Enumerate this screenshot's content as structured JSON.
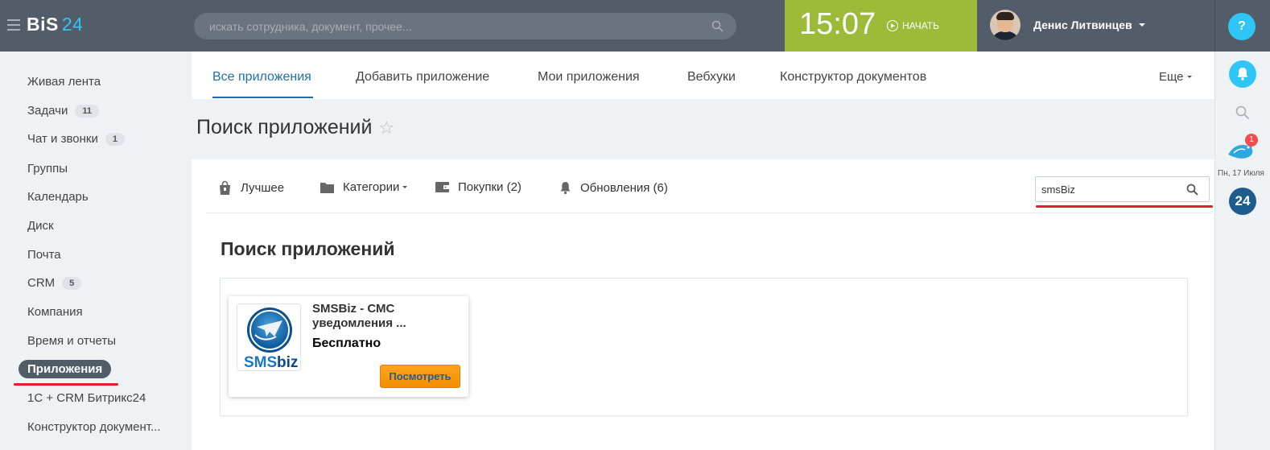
{
  "header": {
    "logo_text": "BiS",
    "logo_num": "24",
    "search_placeholder": "искать сотрудника, документ, прочее...",
    "time": "15:07",
    "start_label": "НАЧАТЬ",
    "user_name": "Денис Литвинцев",
    "help_label": "?"
  },
  "sidebar": {
    "items": [
      {
        "label": "Живая лента"
      },
      {
        "label": "Задачи",
        "badge": "11"
      },
      {
        "label": "Чат и звонки",
        "badge": "1"
      },
      {
        "label": "Группы"
      },
      {
        "label": "Календарь"
      },
      {
        "label": "Диск"
      },
      {
        "label": "Почта"
      },
      {
        "label": "CRM",
        "badge": "5"
      },
      {
        "label": "Компания"
      },
      {
        "label": "Время и отчеты"
      },
      {
        "label": "Приложения",
        "active": true
      },
      {
        "label": "1С + CRM Битрикс24"
      },
      {
        "label": "Конструктор документ..."
      }
    ]
  },
  "rightbar": {
    "notif_count": "1",
    "date": "Пн, 17 Июля",
    "b24_label": "24"
  },
  "tabs": [
    {
      "label": "Все приложения",
      "active": true
    },
    {
      "label": "Добавить приложение"
    },
    {
      "label": "Мои приложения"
    },
    {
      "label": "Вебхуки"
    },
    {
      "label": "Конструктор документов"
    }
  ],
  "more_label": "Еще",
  "page_title": "Поиск приложений",
  "subnav": {
    "best": "Лучшее",
    "categories": "Категории",
    "purchases": "Покупки (2)",
    "updates": "Обновления (6)",
    "search_value": "smsBiz"
  },
  "results": {
    "title": "Поиск приложений",
    "apps": [
      {
        "name": "SMSBiz - СМС уведомления ...",
        "price": "Бесплатно",
        "button": "Посмотреть",
        "logo_text_sms": "SMS",
        "logo_text_biz": "biz"
      }
    ]
  },
  "colors": {
    "topbar": "#535c69",
    "accent": "#2fc6f6",
    "time_bg": "#9dba38",
    "active_tab": "#1e6fb0",
    "highlight_red": "#e41e2b",
    "view_button": "#f28e00"
  }
}
